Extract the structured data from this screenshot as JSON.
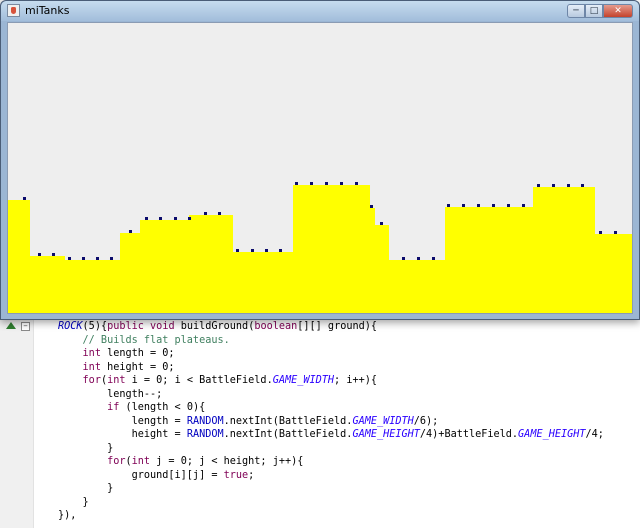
{
  "window": {
    "title": "miTanks",
    "minimize_glyph": "─",
    "maximize_glyph": "□",
    "close_glyph": "✕"
  },
  "colors": {
    "ground": "#ffff00",
    "sky": "#eeeeee",
    "marker": "#0b0b6b"
  },
  "code": {
    "lines": [
      [
        {
          "t": "ROCK",
          "c": "en"
        },
        {
          "t": "(5){"
        },
        {
          "t": "public",
          "c": "kw"
        },
        {
          "t": " "
        },
        {
          "t": "void",
          "c": "kw"
        },
        {
          "t": " buildGround("
        },
        {
          "t": "boolean",
          "c": "kw"
        },
        {
          "t": "[][] ground){"
        }
      ],
      [
        {
          "t": "    // Builds flat plateaus.",
          "c": "cm"
        }
      ],
      [
        {
          "t": "    "
        },
        {
          "t": "int",
          "c": "kw"
        },
        {
          "t": " length = 0;"
        }
      ],
      [
        {
          "t": "    "
        },
        {
          "t": "int",
          "c": "kw"
        },
        {
          "t": " height = 0;"
        }
      ],
      [
        {
          "t": "    "
        },
        {
          "t": "for",
          "c": "kw"
        },
        {
          "t": "("
        },
        {
          "t": "int",
          "c": "kw"
        },
        {
          "t": " i = 0; i < BattleField."
        },
        {
          "t": "GAME_WIDTH",
          "c": "it"
        },
        {
          "t": "; i++){"
        }
      ],
      [
        {
          "t": "        length--;"
        }
      ],
      [
        {
          "t": "        "
        },
        {
          "t": "if",
          "c": "kw"
        },
        {
          "t": " (length < 0){"
        }
      ],
      [
        {
          "t": "            length = "
        },
        {
          "t": "RANDOM",
          "c": "fd"
        },
        {
          "t": ".nextInt(BattleField."
        },
        {
          "t": "GAME_WIDTH",
          "c": "it"
        },
        {
          "t": "/6);"
        }
      ],
      [
        {
          "t": "            height = "
        },
        {
          "t": "RANDOM",
          "c": "fd"
        },
        {
          "t": ".nextInt(BattleField."
        },
        {
          "t": "GAME_HEIGHT",
          "c": "it"
        },
        {
          "t": "/4)+BattleField."
        },
        {
          "t": "GAME_HEIGHT",
          "c": "it"
        },
        {
          "t": "/4;"
        }
      ],
      [
        {
          "t": "        }"
        }
      ],
      [
        {
          "t": "        "
        },
        {
          "t": "for",
          "c": "kw"
        },
        {
          "t": "("
        },
        {
          "t": "int",
          "c": "kw"
        },
        {
          "t": " j = 0; j < height; j++){"
        }
      ],
      [
        {
          "t": "            ground[i][j] = "
        },
        {
          "t": "true",
          "c": "kw"
        },
        {
          "t": ";"
        }
      ],
      [
        {
          "t": "        }"
        }
      ],
      [
        {
          "t": "    }"
        }
      ],
      [
        {
          "t": "}),"
        }
      ]
    ]
  }
}
